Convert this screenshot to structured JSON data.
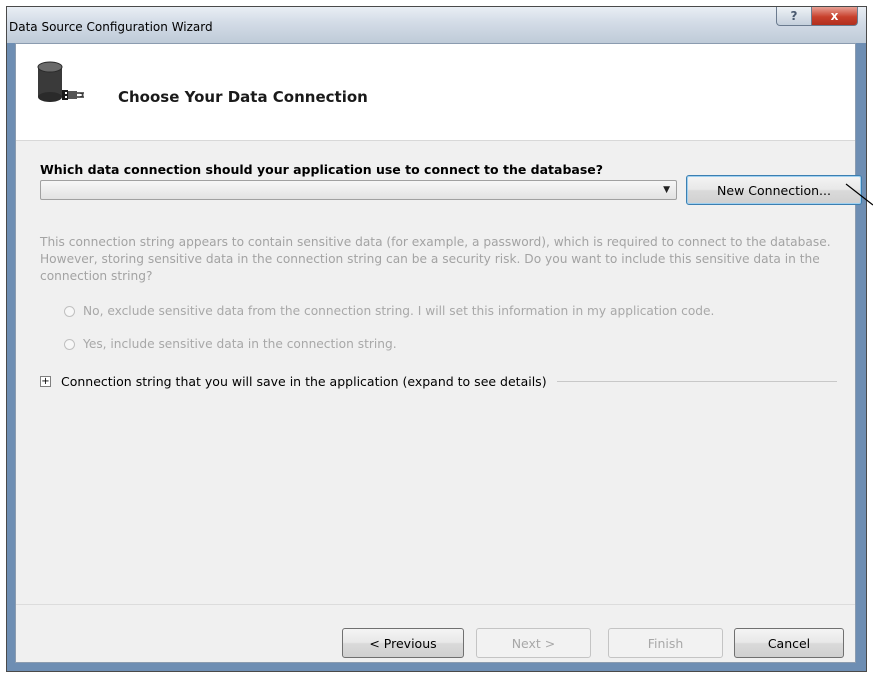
{
  "window": {
    "title": "Data Source Configuration Wizard",
    "help_button": "?",
    "close_button": "x"
  },
  "header": {
    "title": "Choose Your Data Connection",
    "icon": "database-connection-icon"
  },
  "connection": {
    "question": "Which data connection should your application use to connect to the database?",
    "selected_value": "",
    "new_connection_label": "New Connection..."
  },
  "sensitive": {
    "message": "This connection string appears to contain sensitive data (for example, a password), which is required to connect to the database. However, storing sensitive data in the connection string can be a security risk. Do you want to include this sensitive data in the connection string?",
    "option_exclude": "No, exclude sensitive data from the connection string. I will set this information in my application code.",
    "option_include": "Yes, include sensitive data in the connection string."
  },
  "details": {
    "expander_symbol": "+",
    "label": "Connection string that you will save in the application (expand to see details)"
  },
  "footer": {
    "previous": "< Previous",
    "next": "Next >",
    "finish": "Finish",
    "cancel": "Cancel"
  },
  "colors": {
    "title_bar": "#d2dbe6",
    "close_button": "#c8402c",
    "dialog_background": "#f0f0f0",
    "disabled_text": "#a3a3a3",
    "focus_border": "#3c7fb1"
  }
}
